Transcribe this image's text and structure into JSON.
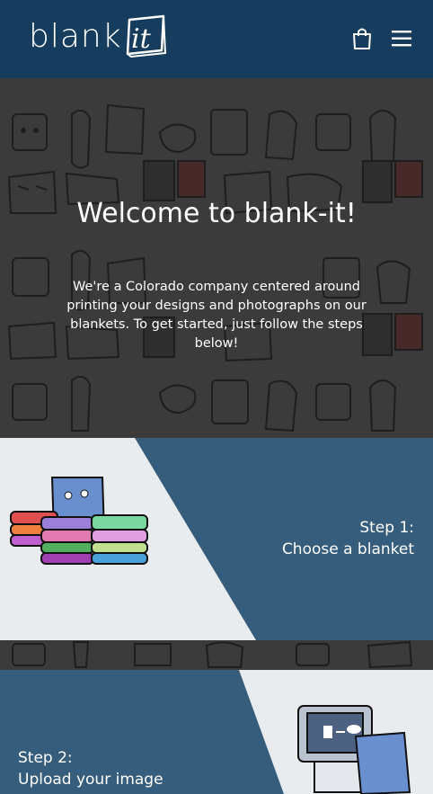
{
  "header": {
    "logo_text": "blank",
    "logo_box_text": "it",
    "cart_icon": "cart-icon",
    "menu_icon": "menu-icon"
  },
  "hero": {
    "title": "Welcome to blank-it!",
    "text": "We're a Colorado company centered around printing your designs and photographs on our blankets. To get started, just follow the steps below!"
  },
  "steps": [
    {
      "label": "Step 1:",
      "title": "Choose a blanket"
    },
    {
      "label": "Step 2:",
      "title": "Upload your image"
    }
  ],
  "colors": {
    "header_bg": "#163d5d",
    "step_bg": "#375d7c",
    "light_bg": "#e9ecef",
    "pattern_bg": "#3b3b3b"
  }
}
